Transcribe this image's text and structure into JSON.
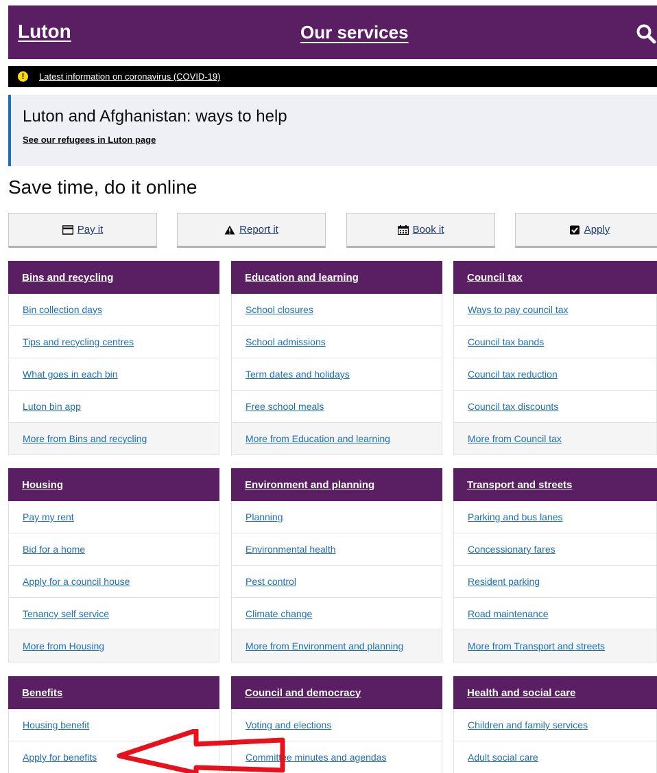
{
  "header": {
    "logo": "Luton",
    "title": "Our services"
  },
  "covid_banner": {
    "link": "Latest information on coronavirus (COVID-19)",
    "icon": "warning-icon"
  },
  "notice": {
    "title": "Luton and Afghanistan: ways to help",
    "link": "See our refugees in Luton page"
  },
  "online": {
    "heading": "Save time, do it online",
    "buttons": [
      {
        "label": "Pay it",
        "icon": "card-icon"
      },
      {
        "label": "Report it",
        "icon": "warning-triangle-icon"
      },
      {
        "label": "Book it",
        "icon": "calendar-icon"
      },
      {
        "label": "Apply",
        "icon": "checkbox-icon"
      }
    ]
  },
  "cards": [
    {
      "title": "Bins and recycling",
      "links": [
        "Bin collection days",
        "Tips and recycling centres",
        "What goes in each bin",
        "Luton bin app"
      ],
      "more": "More from Bins and recycling"
    },
    {
      "title": "Education and learning",
      "links": [
        "School closures",
        "School admissions",
        "Term dates and holidays",
        "Free school meals"
      ],
      "more": "More from Education and learning"
    },
    {
      "title": "Council tax",
      "links": [
        "Ways to pay council tax",
        "Council tax bands",
        "Council tax reduction",
        "Council tax discounts"
      ],
      "more": "More from Council tax"
    },
    {
      "title": "Housing",
      "links": [
        "Pay my rent",
        "Bid for a home",
        "Apply for a council house",
        "Tenancy self service"
      ],
      "more": "More from Housing"
    },
    {
      "title": "Environment and planning",
      "links": [
        "Planning",
        "Environmental health",
        "Pest control",
        "Climate change"
      ],
      "more": "More from Environment and planning"
    },
    {
      "title": "Transport and streets",
      "links": [
        "Parking and bus lanes",
        "Concessionary fares",
        "Resident parking",
        "Road maintenance"
      ],
      "more": "More from Transport and streets"
    },
    {
      "title": "Benefits",
      "links": [
        "Housing benefit",
        "Apply for benefits"
      ]
    },
    {
      "title": "Council and democracy",
      "links": [
        "Voting and elections",
        "Committee minutes and agendas"
      ]
    },
    {
      "title": "Health and social care",
      "links": [
        "Children and family services",
        "Adult social care"
      ]
    }
  ],
  "colors": {
    "brand_purple": "#5a1e63",
    "link_blue": "#1d70b8",
    "annotation_red": "#e8101a"
  }
}
